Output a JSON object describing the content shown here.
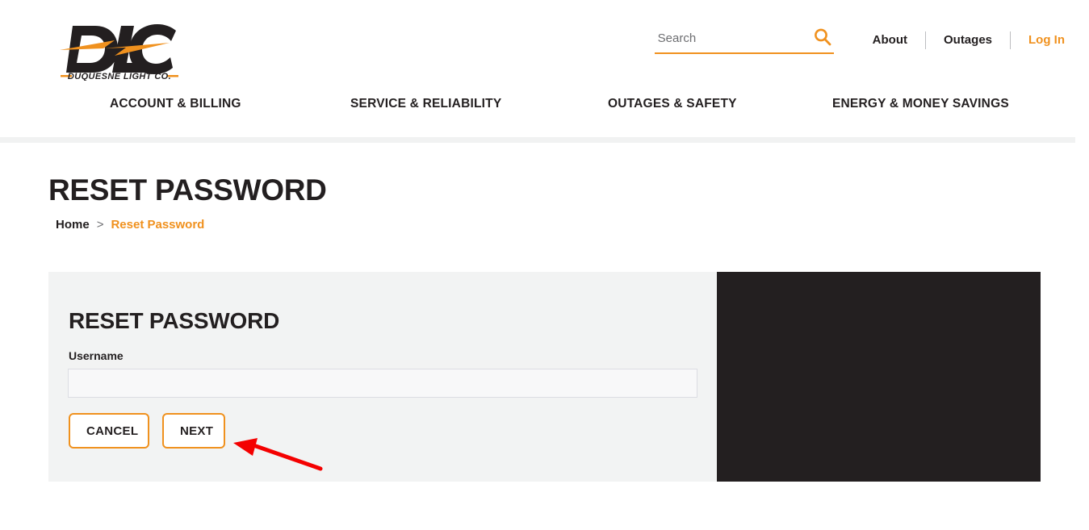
{
  "brand": {
    "logo_text": "DLC",
    "logo_tagline": "DUQUESNE LIGHT CO.",
    "orange": "#f0911e",
    "dark": "#231f20",
    "red_arrow": "#f40000"
  },
  "header": {
    "search": {
      "placeholder": "Search",
      "value": "",
      "icon": "search-icon"
    },
    "links": [
      {
        "label": "About",
        "style": "dark"
      },
      {
        "label": "Outages",
        "style": "dark"
      },
      {
        "label": "Log In",
        "style": "orange"
      }
    ]
  },
  "mainnav": {
    "items": [
      {
        "label": "ACCOUNT & BILLING"
      },
      {
        "label": "SERVICE & RELIABILITY"
      },
      {
        "label": "OUTAGES & SAFETY"
      },
      {
        "label": "ENERGY & MONEY SAVINGS"
      }
    ]
  },
  "page": {
    "title": "RESET PASSWORD",
    "breadcrumb": {
      "home": "Home",
      "separator": ">",
      "current": "Reset Password"
    }
  },
  "card": {
    "title": "RESET PASSWORD",
    "username_label": "Username",
    "username_value": "",
    "username_placeholder": "",
    "buttons": {
      "cancel": "CANCEL",
      "next": "NEXT"
    }
  },
  "annotation": {
    "arrow_target": "next-button"
  }
}
